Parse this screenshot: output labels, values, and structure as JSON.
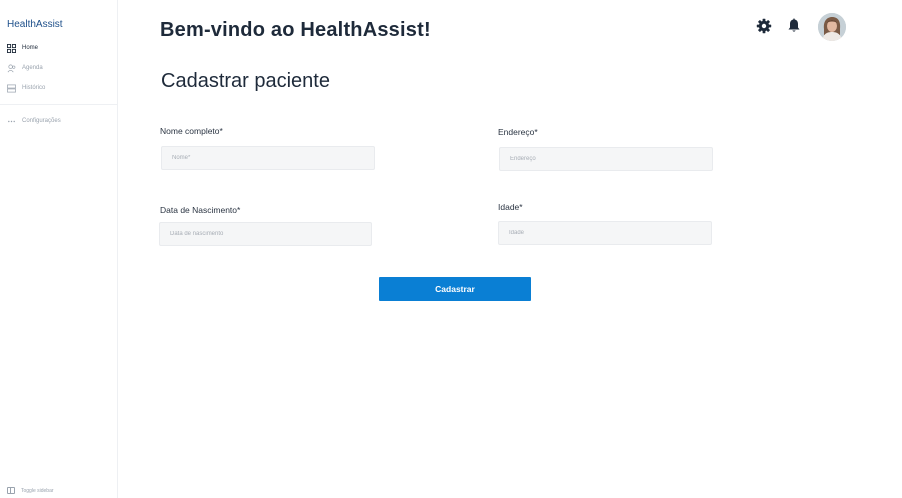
{
  "app": {
    "brand": "HealthAssist"
  },
  "sidebar": {
    "items": [
      {
        "label": "Home",
        "icon": "grid-icon"
      },
      {
        "label": "Agenda",
        "icon": "users-icon"
      },
      {
        "label": "Histórico",
        "icon": "history-icon"
      }
    ],
    "config": {
      "label": "Configurações",
      "icon": "more-icon"
    },
    "toggle": {
      "label": "Toggle sidebar",
      "icon": "sidebar-toggle-icon"
    }
  },
  "header": {
    "welcome": "Bem-vindo ao HealthAssist!",
    "icons": [
      "gear-icon",
      "bell-icon",
      "avatar"
    ]
  },
  "form": {
    "title": "Cadastrar paciente",
    "fields": {
      "nome": {
        "label": "Nome completo*",
        "placeholder": "Nome*"
      },
      "endereco": {
        "label": "Endereço*",
        "placeholder": "Endereço"
      },
      "data": {
        "label": "Data de Nascimento*",
        "placeholder": "Data de nascimento"
      },
      "idade": {
        "label": "Idade*",
        "placeholder": "Idade"
      }
    },
    "submit": "Cadastrar"
  },
  "colors": {
    "accent": "#0a7fd4",
    "brand": "#1d4f8a",
    "text": "#1e2a3a"
  }
}
